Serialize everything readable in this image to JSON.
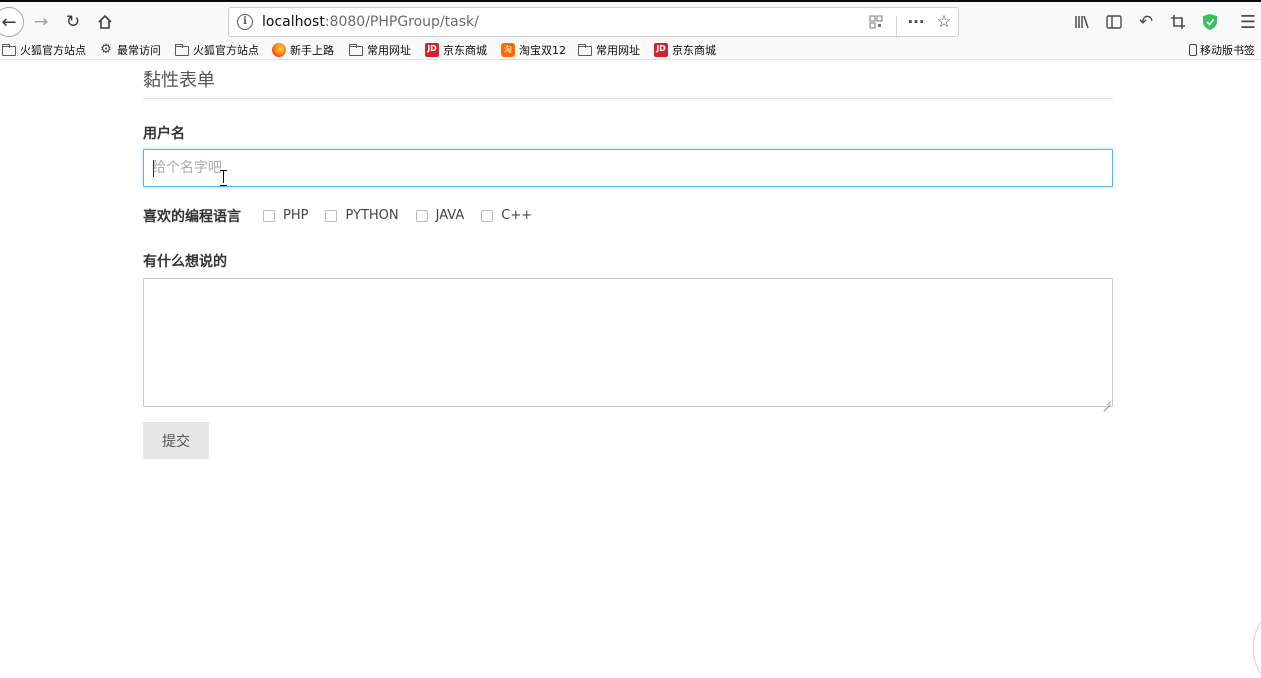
{
  "browser": {
    "url_host": "localhost",
    "url_path": ":8080/PHPGroup/task/",
    "nav": {
      "back_icon": "arrow-left-icon",
      "forward_icon": "arrow-right-icon",
      "reload_icon": "reload-icon",
      "home_icon": "home-icon"
    },
    "bookmarks": [
      {
        "label": "火狐官方站点",
        "icon": "folder-icon"
      },
      {
        "label": "最常访问",
        "icon": "gear-icon"
      },
      {
        "label": "火狐官方站点",
        "icon": "folder-icon"
      },
      {
        "label": "新手上路",
        "icon": "firefox-icon"
      },
      {
        "label": "常用网址",
        "icon": "folder-icon"
      },
      {
        "label": "京东商城",
        "icon": "jd-icon"
      },
      {
        "label": "淘宝双12",
        "icon": "taobao-icon"
      },
      {
        "label": "常用网址",
        "icon": "folder-icon"
      },
      {
        "label": "京东商城",
        "icon": "jd-icon"
      }
    ],
    "mobile_bookmarks": "移动版书签",
    "jd_glyph": "JD",
    "taobao_glyph": "淘"
  },
  "page": {
    "title": "黏性表单",
    "username_label": "用户名",
    "username_placeholder": "给个名字吧",
    "languages_label": "喜欢的编程语言",
    "languages": [
      "PHP",
      "PYTHON",
      "JAVA",
      "C++"
    ],
    "comment_label": "有什么想说的",
    "submit_label": "提交"
  }
}
